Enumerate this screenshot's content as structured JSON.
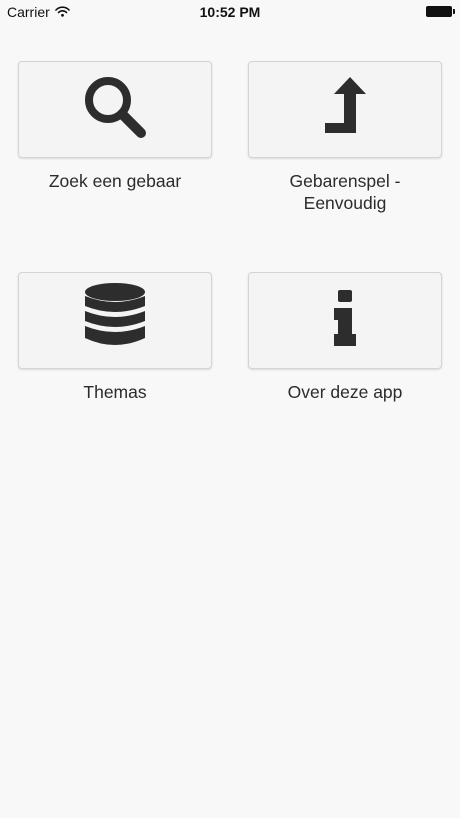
{
  "status_bar": {
    "carrier": "Carrier",
    "time": "10:52 PM"
  },
  "tiles": [
    {
      "label": "Zoek een gebaar",
      "icon": "search-icon"
    },
    {
      "label": "Gebarenspel -\nEenvoudig",
      "icon": "turn-up-arrow-icon"
    },
    {
      "label": "Themas",
      "icon": "database-icon"
    },
    {
      "label": "Over deze app",
      "icon": "info-icon"
    }
  ],
  "colors": {
    "background": "#f8f8f8",
    "tile_background": "#f4f4f4",
    "tile_border": "#d4d4d4",
    "icon": "#2d2d2d"
  }
}
